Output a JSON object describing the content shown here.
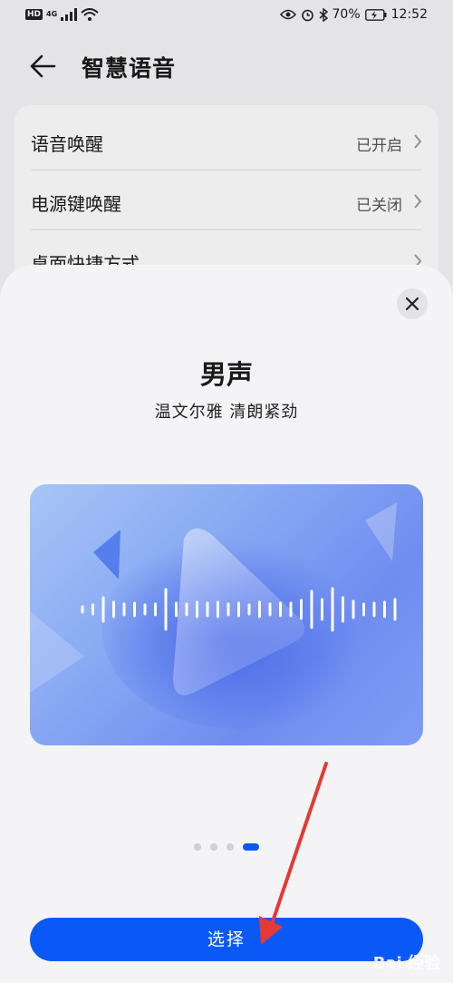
{
  "status_bar": {
    "hd": "HD",
    "network": "4G",
    "battery": "70%",
    "time": "12:52"
  },
  "header": {
    "title": "智慧语音"
  },
  "settings": {
    "items": [
      {
        "label": "语音唤醒",
        "value": "已开启"
      },
      {
        "label": "电源键唤醒",
        "value": "已关闭"
      },
      {
        "label": "桌面快捷方式",
        "value": ""
      }
    ]
  },
  "sheet": {
    "voice_name": "男声",
    "voice_desc": "温文尔雅 清朗紧劲",
    "page_count": 4,
    "active_page": 4,
    "select_label": "选择"
  },
  "watermark": "Bai 经验",
  "colors": {
    "accent": "#0a59f7",
    "annotation_arrow": "#e53935"
  }
}
